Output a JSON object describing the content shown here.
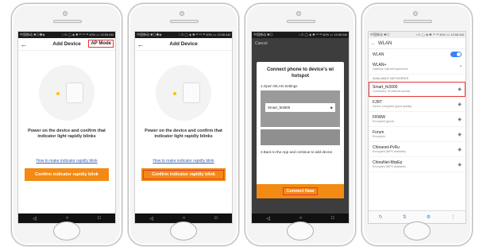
{
  "screen1": {
    "status_left": "中国移动 ✱◎◉◈",
    "status_right": "↕ ⊙ ◯ ◈ ✱ ᵈˡᵗ ⁴⁶ ᵃˡˡ 40% ▭ 13:58 AM",
    "title": "Add Device",
    "ap_mode": "AP Mode",
    "instruction": "Power on the device and confirm that indicator light rapidly blinks",
    "how_to": "How to make indicator rapidly blink",
    "confirm": "Confirm indicator rapidly blink"
  },
  "screen2": {
    "status_left": "中国移动 ✱◎◉◈",
    "status_right": "↕ ⊙ ◯ ◈ ✱ ᵈˡᵗ ⁴⁶ ᵃˡˡ 40% ▭ 13:58 AM",
    "title": "Add Device",
    "instruction": "Power on the device and confirm that indicator light rapidly blinks",
    "how_to": "How to make indicator rapidly blink",
    "confirm": "Confirm indicator rapidly blink"
  },
  "screen3": {
    "status_left": "中国移动 ✱◎",
    "status_right": "↕ ⊙ ◯ ◈ ✱ ⁴⁶ ᵃˡˡ 40% ▭ 13:58 AM",
    "cancel": "Cancel",
    "dialog_title": "Connect phone to device's wi hotspot",
    "step1": "1.Open WLAN Settings",
    "wifi_name": "Smart_fe3000",
    "step2": "2.Back to the App and continue to add device",
    "connect": "Connect Now"
  },
  "screen4": {
    "status_left": "中国移动 ✱◎",
    "status_right": "↕ ⊙ ◯ ◈ ✱ ⁴⁶ ᵃˡˡ 40% ▭ 13:58 AM",
    "header": "WLAN",
    "wlan_label": "WLAN",
    "wlan_plus": "WLAN+",
    "wlan_plus_sub": "Optimise Internet experience",
    "available": "AVAILABLE NETWORKS",
    "networks": [
      {
        "name": "Smart_fe3000",
        "sub": "Connected, no internet access"
      },
      {
        "name": "FJRT",
        "sub": "Saved, encrypted (good quality)"
      },
      {
        "name": "FRWW",
        "sub": "Encrypted (good)"
      },
      {
        "name": "Forum",
        "sub": "Encrypted"
      },
      {
        "name": "Chinanet-PvRu",
        "sub": "Encrypted (WPS available)"
      },
      {
        "name": "ChinaNet-MrpEp",
        "sub": "Encrypted (WPS available)"
      }
    ]
  }
}
